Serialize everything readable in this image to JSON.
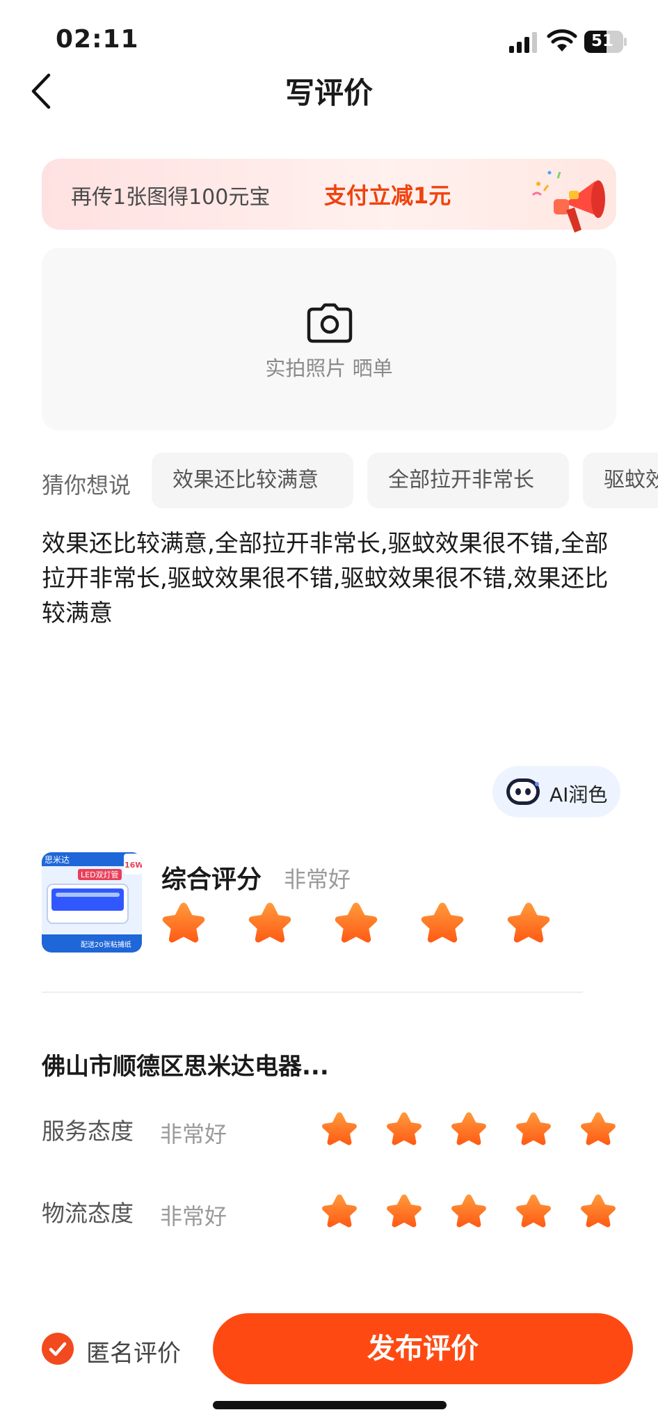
{
  "status_bar": {
    "time": "02:11",
    "battery": "51"
  },
  "nav": {
    "title": "写评价"
  },
  "promo": {
    "text": "再传1张图得100元宝",
    "highlight": "支付立减1元"
  },
  "upload": {
    "label": "实拍照片 晒单"
  },
  "suggestions": {
    "title": "猜你想说",
    "chips": [
      "效果还比较满意",
      "全部拉开非常长",
      "驱蚊效"
    ]
  },
  "review_text": "效果还比较满意,全部拉开非常长,驱蚊效果很不错,全部拉开非常长,驱蚊效果很不错,驱蚊效果很不错,效果还比较满意",
  "ai_polish": {
    "label": "AI润色"
  },
  "product": {
    "thumb_labels": {
      "brand": "思米达",
      "tag": "LED双灯管",
      "watt": "16W",
      "bottom": "配送20张粘捕纸"
    }
  },
  "overall": {
    "label": "综合评分",
    "value": "非常好",
    "stars": 5
  },
  "shop": {
    "name": "佛山市顺德区思米达电器...",
    "rows": [
      {
        "label": "服务态度",
        "value": "非常好",
        "stars": 5
      },
      {
        "label": "物流态度",
        "value": "非常好",
        "stars": 5
      }
    ]
  },
  "bottom": {
    "anonymous_label": "匿名评价",
    "anonymous_checked": true,
    "publish_label": "发布评价"
  },
  "colors": {
    "accent": "#fe4a12",
    "star": "#ff7a1f",
    "promo_highlight": "#f0420e"
  }
}
